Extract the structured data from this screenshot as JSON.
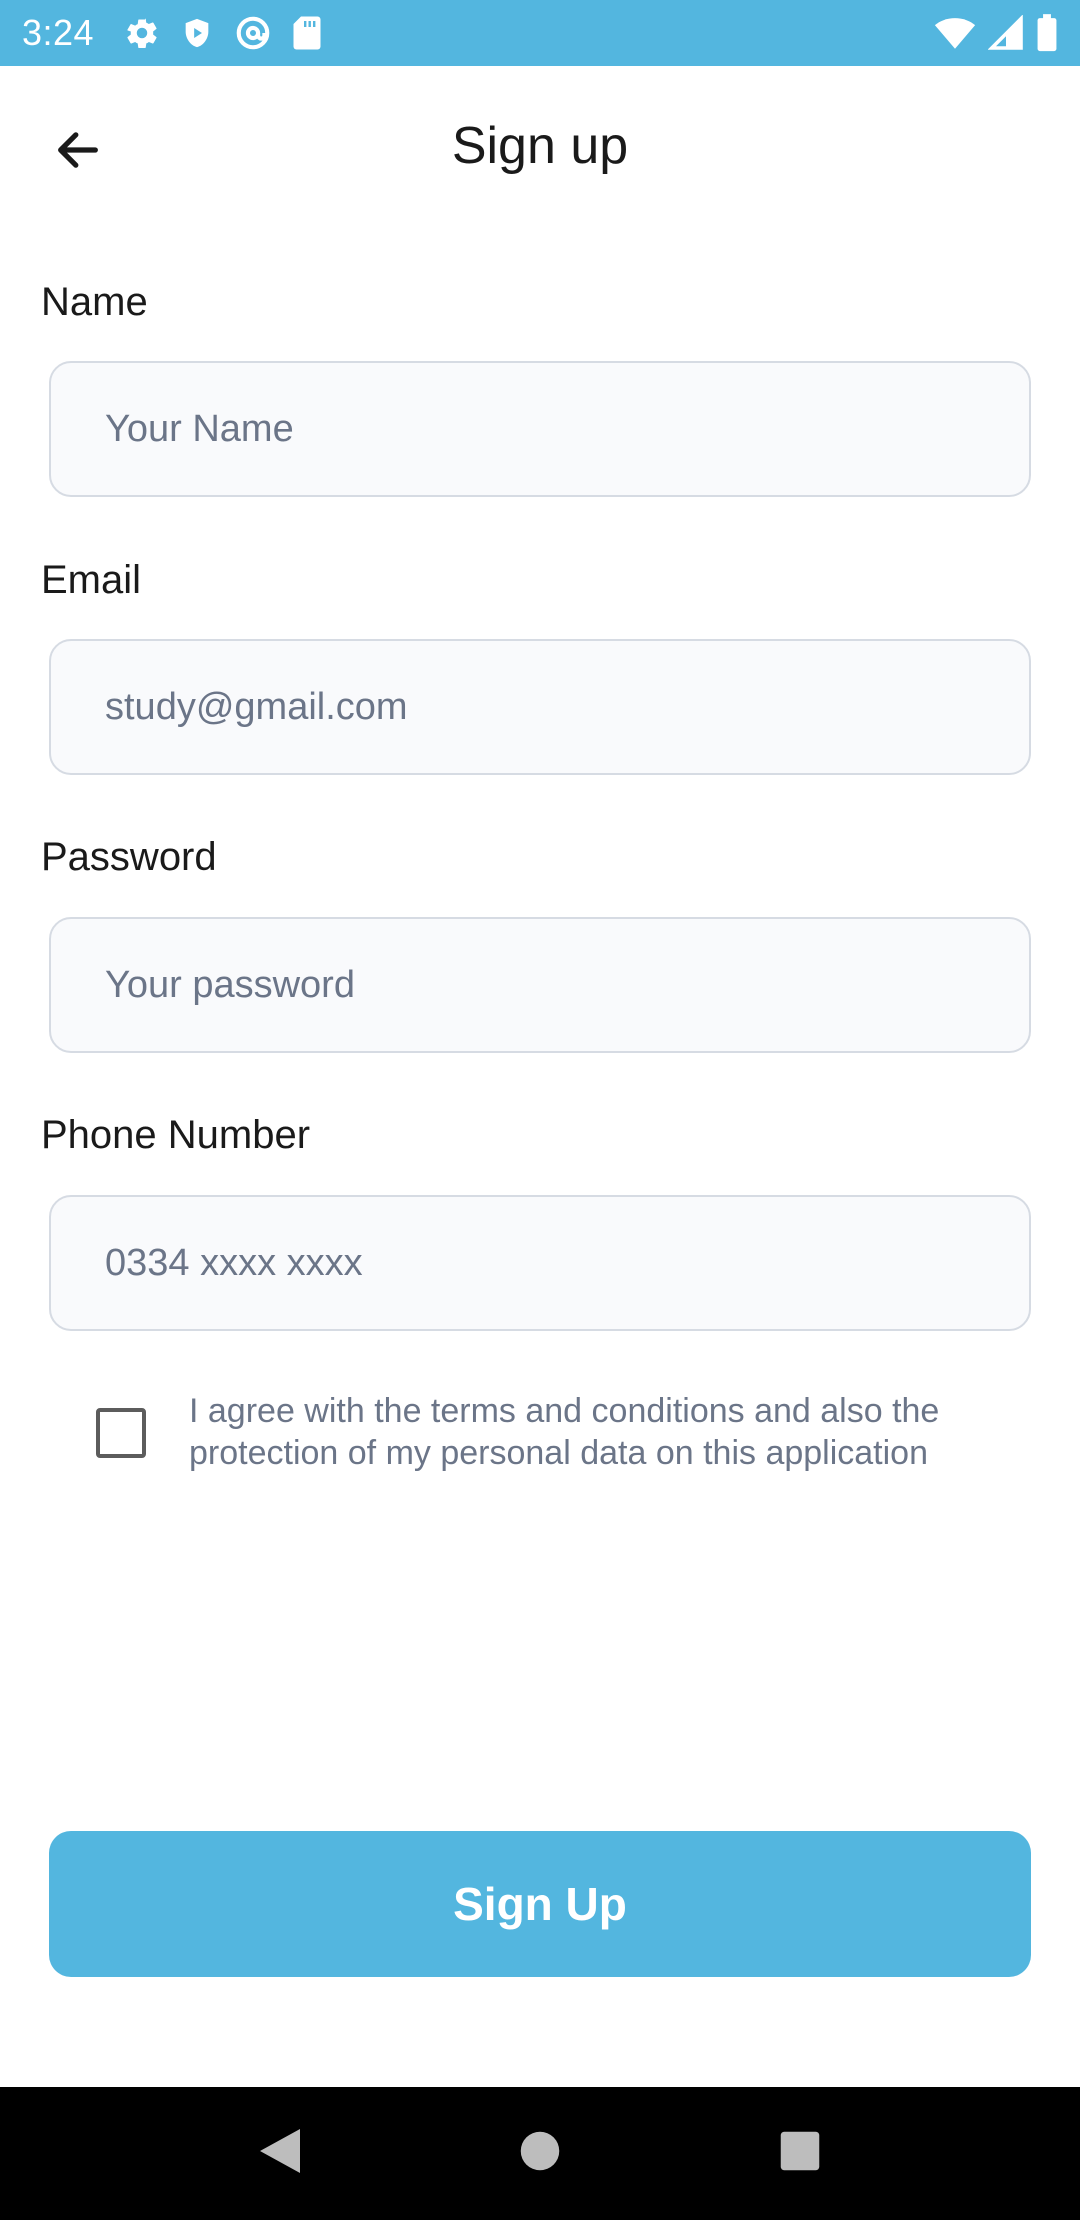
{
  "status_bar": {
    "time": "3:24",
    "left_icons": [
      "gear-icon",
      "shield-play-icon",
      "at-sign-icon",
      "sd-card-icon"
    ],
    "right_icons": [
      "wifi-icon",
      "cell-signal-icon",
      "battery-icon"
    ]
  },
  "header": {
    "title": "Sign up",
    "back_icon": "arrow-left-icon"
  },
  "form": {
    "name": {
      "label": "Name",
      "placeholder": "Your Name",
      "value": ""
    },
    "email": {
      "label": "Email",
      "placeholder": "study@gmail.com",
      "value": ""
    },
    "password": {
      "label": "Password",
      "placeholder": "Your password",
      "value": ""
    },
    "phone": {
      "label": "Phone Number",
      "placeholder": "0334 xxxx xxxx",
      "value": ""
    }
  },
  "agreement": {
    "checked": false,
    "text": "I agree with the terms and conditions and also the protection of my personal data on this application"
  },
  "actions": {
    "signup_label": "Sign Up"
  },
  "nav_bar": {
    "buttons": [
      "back-triangle-icon",
      "home-circle-icon",
      "recents-square-icon"
    ]
  },
  "colors": {
    "accent": "#53b6df",
    "input_bg": "#f9fafc",
    "input_border": "#d6dbe3",
    "placeholder": "#6b7588"
  }
}
